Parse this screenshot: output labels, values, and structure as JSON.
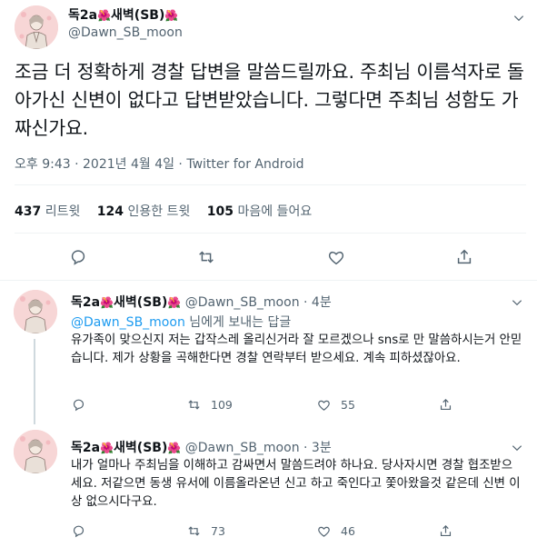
{
  "main_tweet": {
    "display_name": "독2a",
    "flower": "🌺",
    "name_mid": "새벽(SB)",
    "handle": "@Dawn_SB_moon",
    "text": "조금 더 정확하게 경찰 답변을 말씀드릴까요. 주최님 이름석자로 돌아가신 신변이 없다고 답변받았습니다. 그렇다면 주최님 성함도 가짜신가요.",
    "meta": "오후 9:43 · 2021년 4월 4일 · Twitter for Android",
    "retweets_count": "437",
    "retweets_label": "리트윗",
    "quotes_count": "124",
    "quotes_label": "인용한 트윗",
    "likes_count": "105",
    "likes_label": "마음에 들어요"
  },
  "replies": [
    {
      "display_name": "독2a",
      "flower": "🌺",
      "name_mid": "새벽(SB)",
      "handle_time": "@Dawn_SB_moon · 4분",
      "replying_mention": "@Dawn_SB_moon",
      "replying_suffix": " 님에게 보내는 답글",
      "text": "유가족이 맞으신지 저는 갑작스레 올리신거라 잘 모르겠으나 sns로 만 말씀하시는거 안믿습니다. 제가 상황을 곡해한다면 경찰 연락부터 받으세요. 계속 피하셨잖아요.",
      "retweets": "109",
      "likes": "55"
    },
    {
      "display_name": "독2a",
      "flower": "🌺",
      "name_mid": "새벽(SB)",
      "handle_time": "@Dawn_SB_moon · 3분",
      "text": "내가 얼마나 주최님을 이해하고 감싸면서 말씀드려야 하나요. 당사자시면 경찰 협조받으세요. 저같으면 동생 유서에 이름올라온년 신고 하고 죽인다고 쫓아왔을것 같은데 신변 이상 없으시다구요.",
      "retweets": "73",
      "likes": "46"
    }
  ],
  "icons": {
    "reply": "reply-icon",
    "retweet": "retweet-icon",
    "like": "heart-icon",
    "share": "share-icon",
    "more": "chevron-down-icon"
  },
  "colors": {
    "link": "#1d9bf0",
    "secondary": "#536471",
    "flower": "#e8577a"
  }
}
